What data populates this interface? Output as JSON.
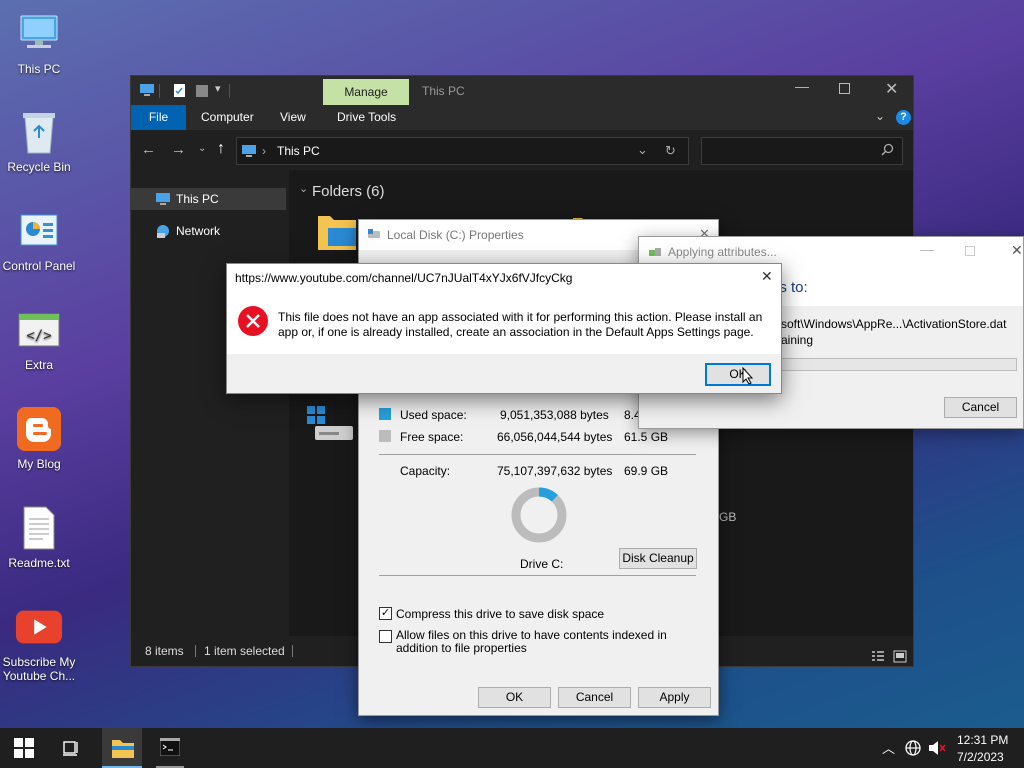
{
  "desktop": {
    "icons": [
      {
        "label": "This PC"
      },
      {
        "label": "Recycle Bin"
      },
      {
        "label": "Control Panel"
      },
      {
        "label": "Extra"
      },
      {
        "label": "My Blog"
      },
      {
        "label": "Readme.txt"
      },
      {
        "label": "Subscribe My Youtube Ch..."
      }
    ]
  },
  "explorer": {
    "title": "This PC",
    "manage_tab": "Manage",
    "ribbon": {
      "file": "File",
      "computer": "Computer",
      "view": "View",
      "drive_tools": "Drive Tools"
    },
    "address": "This PC",
    "search_placeholder": "",
    "nav": {
      "this_pc": "This PC",
      "network": "Network"
    },
    "folders_header": "Folders (6)",
    "partial_drive_text": "GB",
    "status": {
      "items": "8 items",
      "selected": "1 item selected"
    }
  },
  "properties": {
    "title": "Local Disk (C:) Properties",
    "used_label": "Used space:",
    "used_bytes": "9,051,353,088 bytes",
    "used_gb": "8.4",
    "free_label": "Free space:",
    "free_bytes": "66,056,044,544 bytes",
    "free_gb": "61.5 GB",
    "capacity_label": "Capacity:",
    "capacity_bytes": "75,107,397,632 bytes",
    "capacity_gb": "69.9 GB",
    "drive_label": "Drive C:",
    "disk_cleanup": "Disk Cleanup",
    "compress_label": "Compress this drive to save disk space",
    "compress_checked": true,
    "index_label": "Allow files on this drive to have contents indexed in addition to file properties",
    "index_checked": false,
    "ok": "OK",
    "cancel": "Cancel",
    "apply": "Apply",
    "used_fraction": 0.1205,
    "colors": {
      "used": "#26a0da",
      "free": "#bcbcbc"
    }
  },
  "applying": {
    "title": "Applying attributes...",
    "heading": "es to:",
    "path": "soft\\Windows\\AppRe...\\ActivationStore.dat",
    "remaining": "aining",
    "cancel": "Cancel"
  },
  "error": {
    "title": "https://www.youtube.com/channel/UC7nJUalT4xYJx6fVJfcyCkg",
    "message": "This file does not have an app associated with it for performing this action. Please install an app or, if one is already installed, create an association in the Default Apps Settings page.",
    "ok": "OK"
  },
  "taskbar": {
    "time": "12:31 PM",
    "date": "7/2/2023"
  },
  "colors": {
    "accent": "#0063b1",
    "manage_tab": "#c5e1a5",
    "error_red": "#e81123"
  }
}
